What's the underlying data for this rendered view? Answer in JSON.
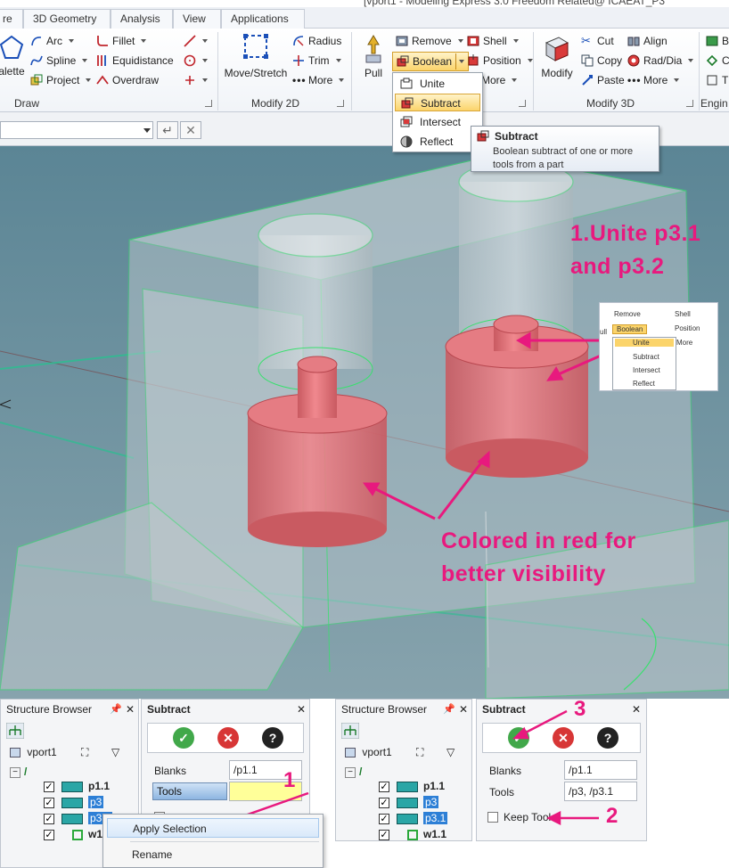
{
  "window": {
    "title": "[vport1 - Modeling Express 3.0 Freedom Related@ ICAEAT_P3"
  },
  "tabs": [
    "re",
    "3D Geometry",
    "Analysis",
    "View",
    "Applications"
  ],
  "ribbon": {
    "draw": {
      "label": "Draw",
      "palette_label": "alette",
      "arc_label": "Arc",
      "spline_label": "Spline",
      "project_label": "Project",
      "fillet_label": "Fillet",
      "equidistance_label": "Equidistance",
      "overdraw_label": "Overdraw"
    },
    "modify2d": {
      "label": "Modify 2D",
      "move_stretch_label": "Move/Stretch",
      "radius_label": "Radius",
      "trim_label": "Trim",
      "more_label": "More"
    },
    "boolean_group": {
      "pull_label": "Pull",
      "remove_label": "Remove",
      "boolean_label": "Boolean",
      "shell_label": "Shell",
      "position_label": "Position",
      "more_label": "More"
    },
    "modify3d": {
      "label": "Modify 3D",
      "modify_label": "Modify",
      "cut_label": "Cut",
      "copy_label": "Copy",
      "paste_label": "Paste",
      "align_label": "Align",
      "raddia_label": "Rad/Dia",
      "more_label": "More"
    },
    "engine": {
      "label": "Engin",
      "b_label": "B",
      "c_label": "C",
      "t_label": "T"
    }
  },
  "boolean_menu": {
    "items": [
      {
        "label": "Unite"
      },
      {
        "label": "Subtract"
      },
      {
        "label": "Intersect"
      },
      {
        "label": "Reflect"
      }
    ]
  },
  "tooltip": {
    "title": "Subtract",
    "body_line1": "Boolean subtract of one or more",
    "body_line2": "tools from a part"
  },
  "annotations": {
    "unite_line1": "1.Unite p3.1",
    "unite_line2": "and p3.2",
    "red_line1": "Colored in red for",
    "red_line2": "better visibility"
  },
  "inset": {
    "remove": "Remove",
    "shell": "Shell",
    "pull": "ull",
    "boolean": "Boolean",
    "position": "Position",
    "more": "More",
    "items": [
      "Unite",
      "Subtract",
      "Intersect",
      "Reflect"
    ]
  },
  "structure_browser": {
    "title": "Structure Browser",
    "root": "vport1",
    "nodes": [
      {
        "label": "p1.1",
        "selected": false
      },
      {
        "label": "p3",
        "selected": true
      },
      {
        "label": "p3.1",
        "selected": true
      },
      {
        "label": "w1.1",
        "selected": false
      }
    ]
  },
  "subtract_panel_left": {
    "title": "Subtract",
    "blanks_label": "Blanks",
    "blanks_value": "/p1.1",
    "tools_label": "Tools",
    "tools_value": ""
  },
  "context_menu": {
    "apply_selection": "Apply Selection",
    "rename": "Rename"
  },
  "subtract_panel_right": {
    "title": "Subtract",
    "blanks_label": "Blanks",
    "blanks_value": "/p1.1",
    "tools_label": "Tools",
    "tools_value": "/p3, /p3.1",
    "keep_tool_label": "Keep Tool"
  },
  "step_numbers": {
    "one": "1",
    "two": "2",
    "three": "3"
  },
  "colors": {
    "annotation": "#e8197e",
    "highlight": "#fbd46b",
    "selection": "#2d7fd6",
    "ok_green": "#41a84a",
    "cancel_red": "#d73636"
  }
}
